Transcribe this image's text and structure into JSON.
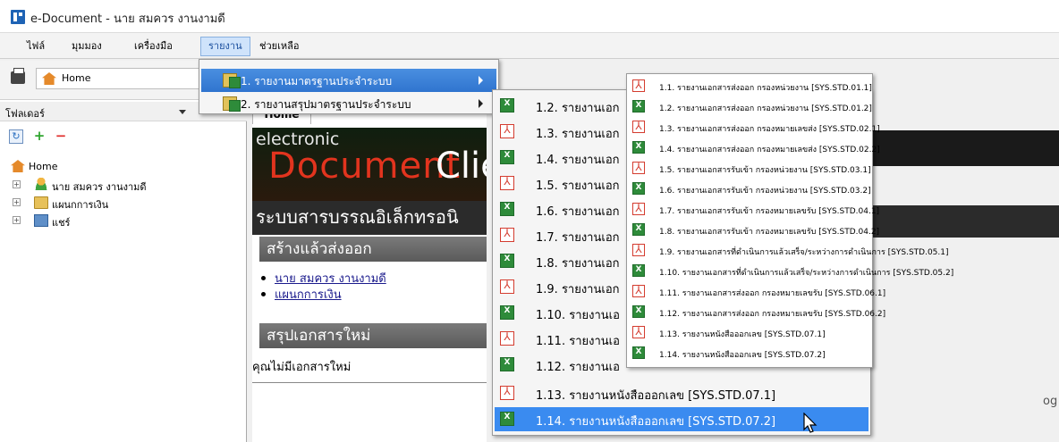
{
  "window": {
    "title": "e-Document - นาย สมควร งานงามดี"
  },
  "menubar": {
    "items": [
      {
        "label": "ไฟล์"
      },
      {
        "label": "มุมมอง"
      },
      {
        "label": "เครื่องมือ"
      },
      {
        "label": "รายงาน"
      },
      {
        "label": "ช่วยเหลือ"
      }
    ]
  },
  "address": {
    "label": "Home"
  },
  "folders": {
    "title": "โฟลเดอร์",
    "tree": [
      {
        "label": "Home"
      },
      {
        "label": "นาย สมควร งานงามดี"
      },
      {
        "label": "แผนกการเงิน"
      },
      {
        "label": "แชร์"
      }
    ]
  },
  "main": {
    "tab_label": "Home",
    "banner_line1": "electronic",
    "banner_doc": "Document",
    "banner_client": "Clie",
    "system_title": "ระบบสารบรรณอิเล็กทรอนิ",
    "sent_section": "สร้างแล้วส่งออก",
    "sent_links": [
      "นาย สมควร งานงามดี",
      "แผนกการเงิน"
    ],
    "new_section": "สรุปเอกสารใหม่",
    "no_new_docs": "คุณไม่มีเอกสารใหม่",
    "right_text": "og"
  },
  "report_menu": {
    "items": [
      {
        "label": "1. รายงานมาตรฐานประจำระบบ"
      },
      {
        "label": "2. รายงานสรุปมาตรฐานประจำระบบ"
      }
    ]
  },
  "submenu_large": {
    "items": [
      {
        "label": "1.2. รายงานเอก",
        "icon": "excel-icon"
      },
      {
        "label": "1.3. รายงานเอก",
        "icon": "pdf-icon"
      },
      {
        "label": "1.4. รายงานเอก",
        "icon": "excel-icon"
      },
      {
        "label": "1.5. รายงานเอก",
        "icon": "pdf-icon"
      },
      {
        "label": "1.6. รายงานเอก",
        "icon": "excel-icon"
      },
      {
        "label": "1.7. รายงานเอก",
        "icon": "pdf-icon"
      },
      {
        "label": "1.8. รายงานเอก",
        "icon": "excel-icon"
      },
      {
        "label": "1.9. รายงานเอก",
        "icon": "pdf-icon"
      },
      {
        "label": "1.10. รายงานเอ",
        "icon": "excel-icon"
      },
      {
        "label": "1.11. รายงานเอ",
        "icon": "pdf-icon"
      },
      {
        "label": "1.12. รายงานเอ",
        "icon": "excel-icon"
      },
      {
        "label": "1.13. รายงานหนังสือออกเลข [SYS.STD.07.1]",
        "icon": "pdf-icon"
      },
      {
        "label": "1.14. รายงานหนังสือออกเลข [SYS.STD.07.2]",
        "icon": "excel-icon"
      }
    ]
  },
  "submenu_small": {
    "items": [
      {
        "label": "1.1. รายงานเอกสารส่งออก กรองหน่วยงาน [SYS.STD.01.1]",
        "icon": "pdf-icon"
      },
      {
        "label": "1.2. รายงานเอกสารส่งออก กรองหน่วยงาน [SYS.STD.01.2]",
        "icon": "excel-icon"
      },
      {
        "label": "1.3. รายงานเอกสารส่งออก กรองหมายเลขส่ง [SYS.STD.02.1]",
        "icon": "pdf-icon"
      },
      {
        "label": "1.4. รายงานเอกสารส่งออก กรองหมายเลขส่ง [SYS.STD.02.2]",
        "icon": "excel-icon"
      },
      {
        "label": "1.5. รายงานเอกสารรับเข้า กรองหน่วยงาน [SYS.STD.03.1]",
        "icon": "pdf-icon"
      },
      {
        "label": "1.6. รายงานเอกสารรับเข้า กรองหน่วยงาน [SYS.STD.03.2]",
        "icon": "excel-icon"
      },
      {
        "label": "1.7. รายงานเอกสารรับเข้า กรองหมายเลขรับ [SYS.STD.04.1]",
        "icon": "pdf-icon"
      },
      {
        "label": "1.8. รายงานเอกสารรับเข้า กรองหมายเลขรับ [SYS.STD.04.2]",
        "icon": "excel-icon"
      },
      {
        "label": "1.9. รายงานเอกสารที่ดำเนินการแล้วเสร็จ/ระหว่างการดำเนินการ [SYS.STD.05.1]",
        "icon": "pdf-icon"
      },
      {
        "label": "1.10. รายงานเอกสารที่ดำเนินการแล้วเสร็จ/ระหว่างการดำเนินการ [SYS.STD.05.2]",
        "icon": "excel-icon"
      },
      {
        "label": "1.11. รายงานเอกสารส่งออก กรองหมายเลขรับ [SYS.STD.06.1]",
        "icon": "pdf-icon"
      },
      {
        "label": "1.12. รายงานเอกสารส่งออก กรองหมายเลขรับ [SYS.STD.06.2]",
        "icon": "excel-icon"
      },
      {
        "label": "1.13. รายงานหนังสือออกเลข [SYS.STD.07.1]",
        "icon": "pdf-icon"
      },
      {
        "label": "1.14. รายงานหนังสือออกเลข [SYS.STD.07.2]",
        "icon": "excel-icon"
      }
    ]
  },
  "colors": {
    "menu_highlight": "#3a8bf0",
    "report_hover": "#2f74cf",
    "pdf_red": "#d43c2f",
    "excel_green": "#2e8b3a"
  }
}
